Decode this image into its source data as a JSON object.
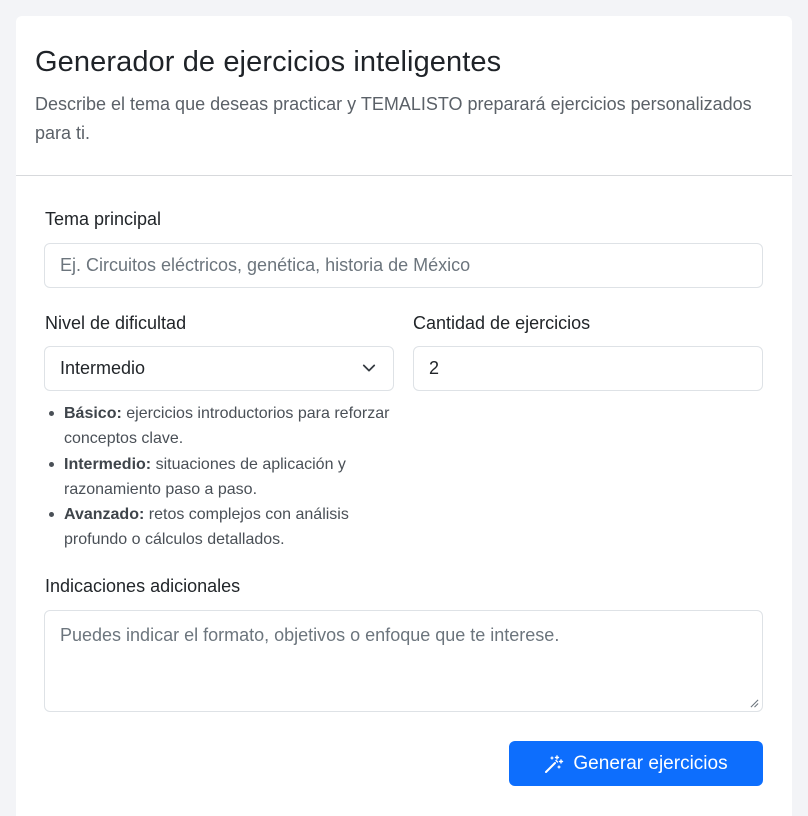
{
  "header": {
    "title": "Generador de ejercicios inteligentes",
    "subtitle": "Describe el tema que deseas practicar y TEMALISTO preparará ejercicios personalizados para ti."
  },
  "form": {
    "topic": {
      "label": "Tema principal",
      "placeholder": "Ej. Circuitos eléctricos, genética, historia de México"
    },
    "difficulty": {
      "label": "Nivel de dificultad",
      "selected": "Intermedio",
      "levels": [
        {
          "name": "Básico:",
          "desc": "ejercicios introductorios para reforzar conceptos clave."
        },
        {
          "name": "Intermedio:",
          "desc": "situaciones de aplicación y razonamiento paso a paso."
        },
        {
          "name": "Avanzado:",
          "desc": "retos complejos con análisis profundo o cálculos detallados."
        }
      ]
    },
    "quantity": {
      "label": "Cantidad de ejercicios",
      "value": "2"
    },
    "instructions": {
      "label": "Indicaciones adicionales",
      "placeholder": "Puedes indicar el formato, objetivos o enfoque que te interese."
    },
    "submit": {
      "label": "Generar ejercicios",
      "icon": "magic-wand-icon"
    }
  },
  "colors": {
    "primary": "#0d6efd",
    "background": "#f3f4f7",
    "border": "#dee2e6"
  }
}
